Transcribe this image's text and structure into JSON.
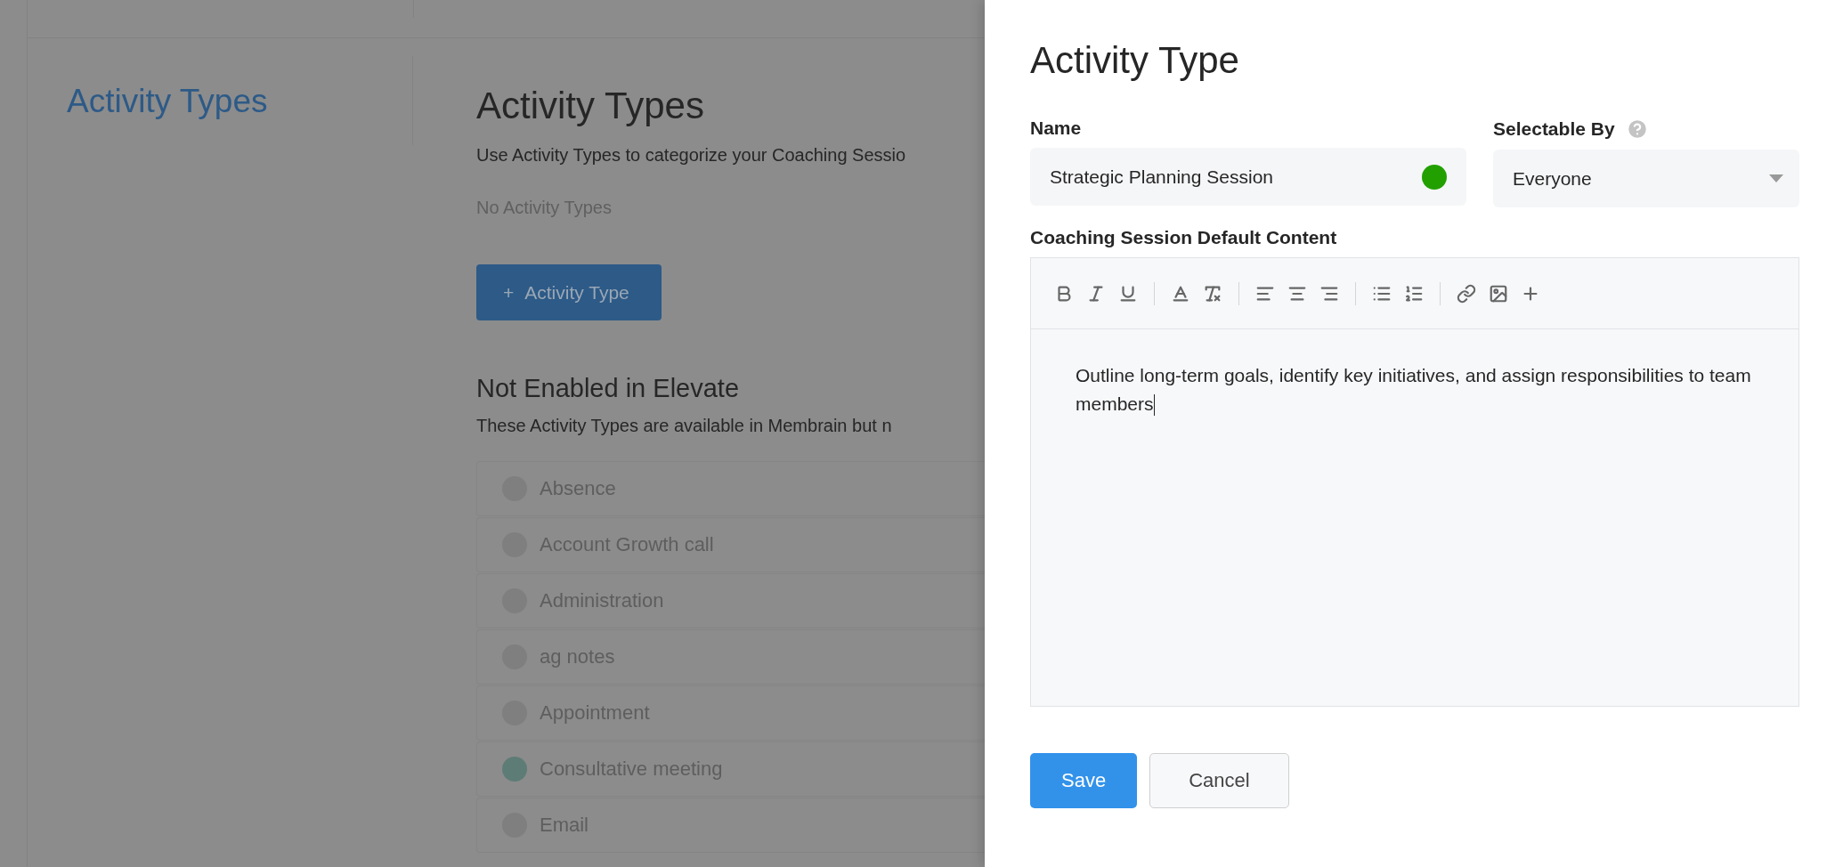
{
  "sidebar": {
    "title": "Activity Types"
  },
  "main": {
    "title": "Activity Types",
    "description": "Use Activity Types to categorize your Coaching Sessio",
    "empty_text": "No Activity Types",
    "add_button": {
      "icon": "+",
      "label": "Activity Type"
    },
    "section_title": "Not Enabled in Elevate",
    "section_description": "These Activity Types are available in Membrain but n",
    "items": [
      {
        "label": "Absence",
        "color": "#7f7f7f"
      },
      {
        "label": "Account Growth call",
        "color": "#7f7f7f"
      },
      {
        "label": "Administration",
        "color": "#7f7f7f"
      },
      {
        "label": "ag notes",
        "color": "#7f7f7f"
      },
      {
        "label": "Appointment",
        "color": "#7f7f7f"
      },
      {
        "label": "Consultative meeting",
        "color": "#5e7c76"
      },
      {
        "label": "Email",
        "color": "#7f7f7f"
      }
    ]
  },
  "panel": {
    "title": "Activity Type",
    "name_field": {
      "label": "Name",
      "value": "Strategic Planning Session",
      "color": "#22a000"
    },
    "selectable_field": {
      "label": "Selectable By",
      "value": "Everyone"
    },
    "content_label": "Coaching Session Default Content",
    "content_text": "Outline long-term goals, identify key initiatives, and assign responsibilities to team members",
    "buttons": [
      {
        "label": "Save",
        "kind": "primary"
      },
      {
        "label": "Cancel",
        "kind": "secondary"
      }
    ]
  }
}
